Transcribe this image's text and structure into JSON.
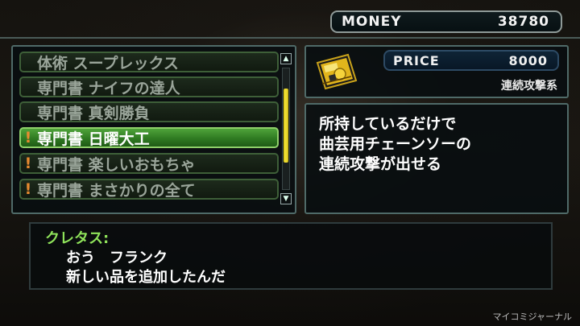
{
  "money": {
    "label": "MONEY",
    "value": "38780"
  },
  "list": {
    "items": [
      {
        "label": "体術 スープレックス",
        "mark": "",
        "selected": false
      },
      {
        "label": "専門書 ナイフの達人",
        "mark": "",
        "selected": false
      },
      {
        "label": "専門書 真剣勝負",
        "mark": "",
        "selected": false
      },
      {
        "label": "専門書 日曜大工",
        "mark": "!",
        "selected": true
      },
      {
        "label": "専門書 楽しいおもちゃ",
        "mark": "!",
        "selected": false
      },
      {
        "label": "専門書 まさかりの全て",
        "mark": "!",
        "selected": false
      }
    ],
    "scroll_position": 0.45
  },
  "detail": {
    "price_label": "PRICE",
    "price_value": "8000",
    "category": "連続攻撃系",
    "icon": "book-item-icon",
    "description": [
      "所持しているだけで",
      "曲芸用チェーンソーの",
      "連続攻撃が出せる"
    ]
  },
  "dialogue": {
    "speaker": "クレタス:",
    "lines": [
      "おう　フランク",
      "新しい品を追加したんだ"
    ]
  },
  "watermark": "マイコミジャーナル",
  "colors": {
    "selected": "#3f8f2e",
    "speaker": "#8fe35a",
    "warning_mark": "#e88a30",
    "scroll_thumb": "#e6d52a"
  }
}
